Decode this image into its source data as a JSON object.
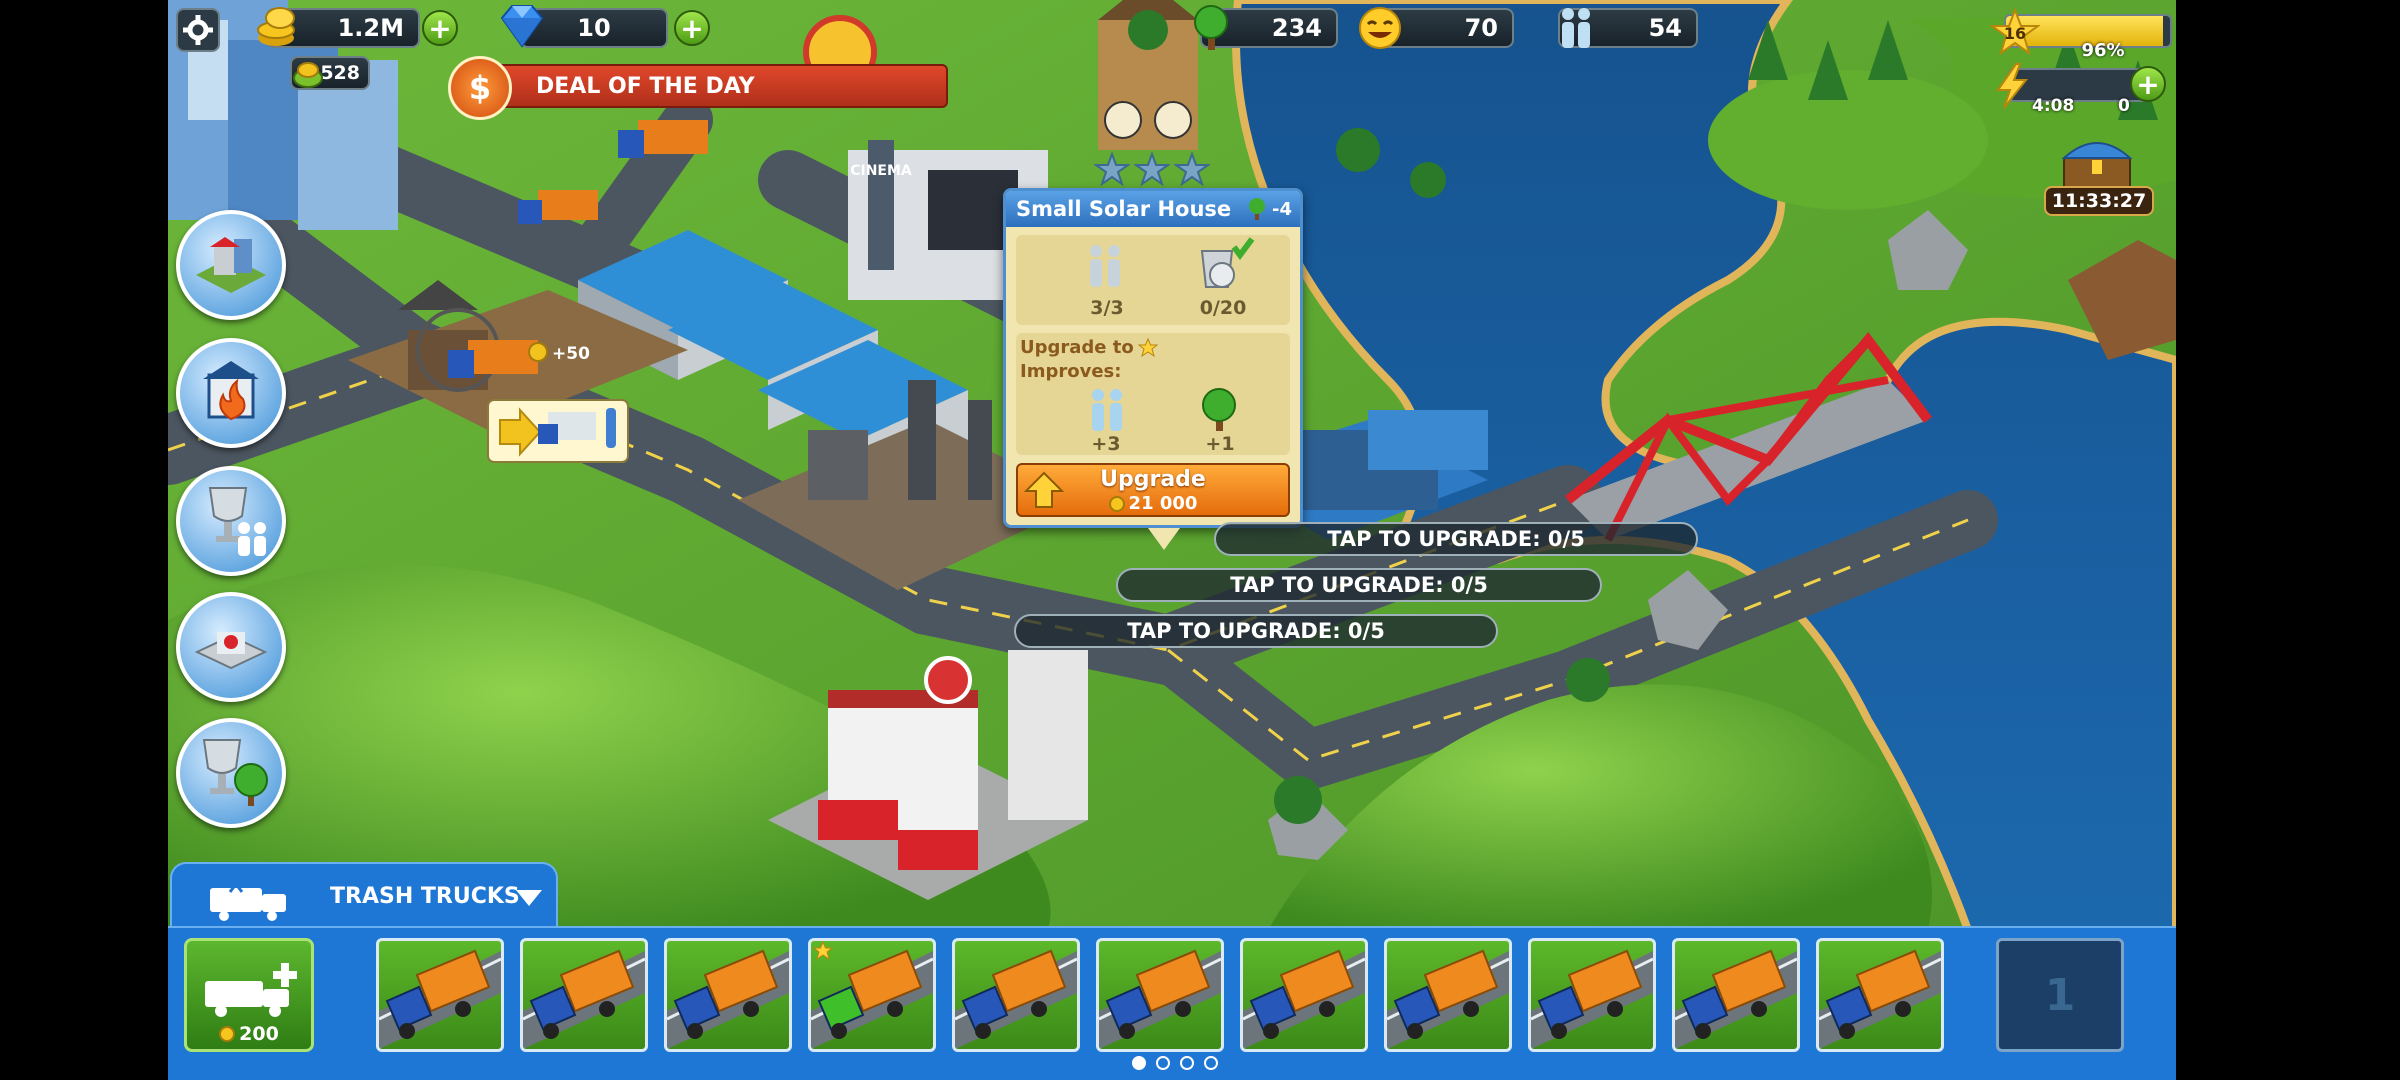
{
  "hud": {
    "coins": "1.2M",
    "gems": "10",
    "bonus": "528",
    "deal_label": "DEAL OF THE DAY",
    "deal_symbol": "$",
    "trees": "234",
    "happiness": "70",
    "population": "54",
    "level": "16",
    "xp_percent_text": "96%",
    "xp_fraction": 0.96,
    "energy_timer": "4:08",
    "energy_count": "0",
    "chest_timer": "11:33:27"
  },
  "map_labels": {
    "cinema_sign": "CINEMA",
    "coin_gain": "+50"
  },
  "popup": {
    "title": "Small Solar House",
    "tree_cost": "-4",
    "residents": "3/3",
    "trash": "0/20",
    "upgrade_to": "Upgrade to",
    "improves": "Improves:",
    "residents_bonus": "+3",
    "trees_bonus": "+1",
    "upgrade_label": "Upgrade",
    "upgrade_cost": "21 000",
    "stars": 3
  },
  "tap_labels": [
    "TAP TO UPGRADE: 0/5",
    "TAP TO UPGRADE: 0/5",
    "TAP TO UPGRADE: 0/5"
  ],
  "bottom": {
    "tab_label": "TRASH TRUCKS",
    "buy_cost": "200",
    "truck_count": 11,
    "starred_truck_index": 3,
    "locked_slot": "1",
    "pages": 4,
    "active_page": 0
  },
  "colors": {
    "panel_blue": "#1e77d4",
    "grass": "#5aa72a",
    "water": "#1b5b9c",
    "bridge_red": "#d8232a",
    "upgrade_orange": "#f08a1c"
  },
  "icons": [
    "settings-gear-icon",
    "coin-icon",
    "gem-icon",
    "bonus-coin-icon",
    "tree-icon",
    "happiness-face-icon",
    "population-icon",
    "level-star-icon",
    "energy-bolt-icon",
    "treasure-chest-icon",
    "fire-icon",
    "trophy-icon",
    "trash-truck-icon",
    "chevron-down-icon"
  ]
}
